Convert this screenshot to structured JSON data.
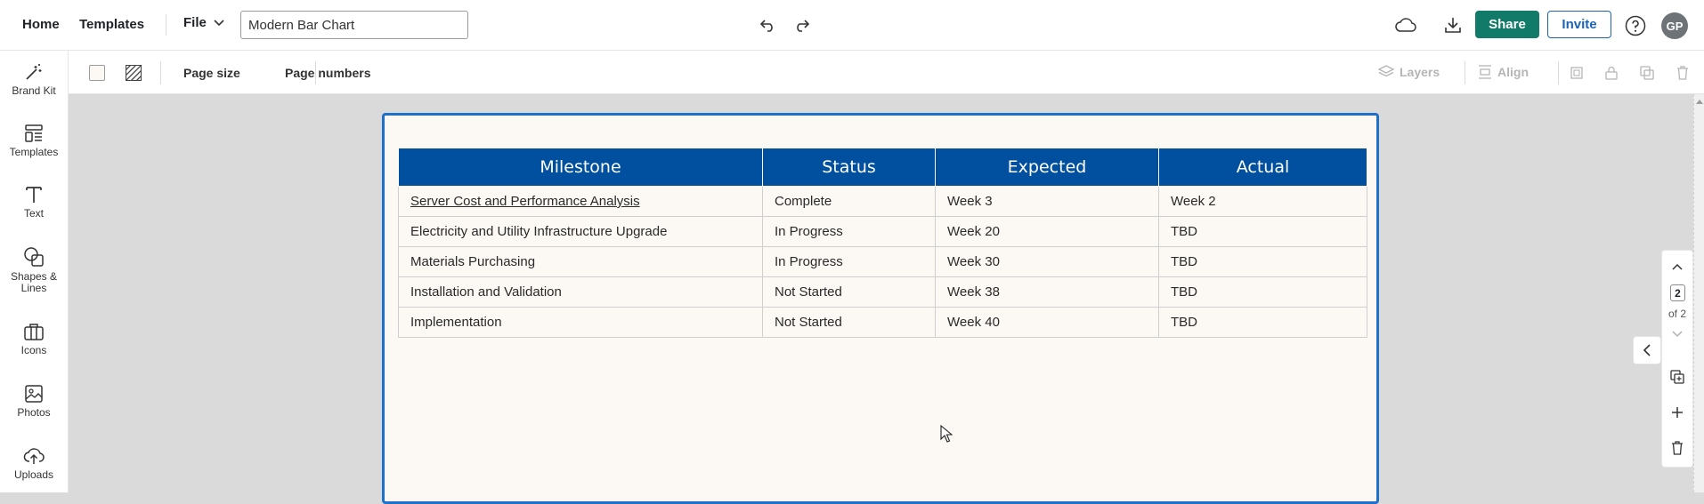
{
  "topbar": {
    "home_label": "Home",
    "templates_label": "Templates",
    "file_label": "File",
    "document_title": "Modern Bar Chart",
    "share_label": "Share",
    "invite_label": "Invite",
    "avatar_initials": "GP"
  },
  "sidebar": {
    "items": [
      {
        "label": "Brand Kit",
        "icon": "magic-wand-icon"
      },
      {
        "label": "Templates",
        "icon": "templates-icon"
      },
      {
        "label": "Text",
        "icon": "text-icon"
      },
      {
        "label": "Shapes & Lines",
        "icon": "shapes-icon"
      },
      {
        "label": "Icons",
        "icon": "briefcase-icon"
      },
      {
        "label": "Photos",
        "icon": "image-icon"
      },
      {
        "label": "Uploads",
        "icon": "upload-icon"
      }
    ]
  },
  "toolbar": {
    "page_size_label": "Page size",
    "page_numbers_label": "Page numbers",
    "layers_label": "Layers",
    "align_label": "Align"
  },
  "table": {
    "headers": [
      "Milestone",
      "Status",
      "Expected",
      "Actual"
    ],
    "rows": [
      [
        "Server Cost and Performance Analysis",
        "Complete",
        "Week 3",
        "Week 2"
      ],
      [
        "Electricity and Utility Infrastructure Upgrade",
        "In Progress",
        "Week 20",
        "TBD"
      ],
      [
        "Materials Purchasing",
        "In Progress",
        "Week 30",
        "TBD"
      ],
      [
        "Installation and Validation",
        "Not Started",
        "Week 38",
        "TBD"
      ],
      [
        "Implementation",
        "Not Started",
        "Week 40",
        "TBD"
      ]
    ]
  },
  "pager": {
    "current_page": "2",
    "of_label": "of 2"
  },
  "colors": {
    "accent_green": "#117a68",
    "accent_blue": "#1b63b8",
    "table_header": "#00509f",
    "page_background": "#fcf8f4",
    "selection_border": "#1f70c9"
  }
}
